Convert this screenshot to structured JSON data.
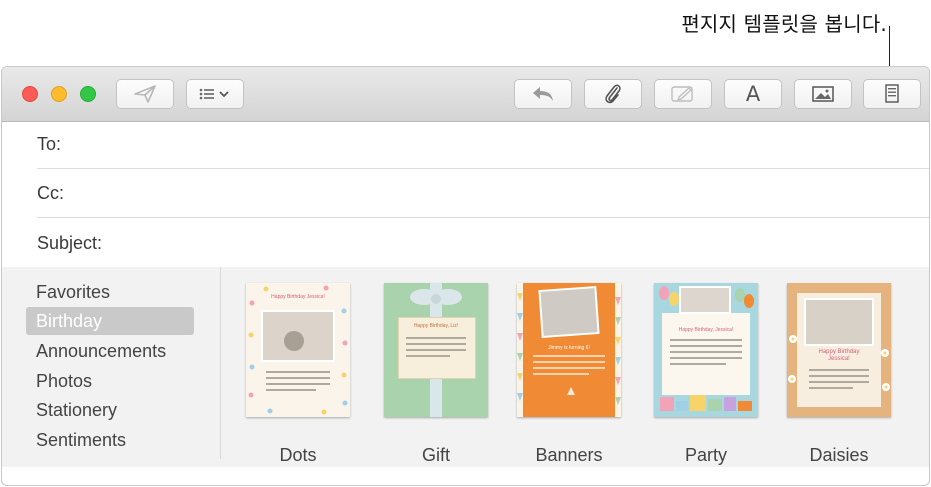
{
  "callout": {
    "text": "편지지 템플릿을 봅니다."
  },
  "headers": {
    "to": "To:",
    "cc": "Cc:",
    "subject": "Subject:"
  },
  "toolbar": {
    "font_label": "A"
  },
  "categories": [
    {
      "label": "Favorites",
      "selected": false
    },
    {
      "label": "Birthday",
      "selected": true
    },
    {
      "label": "Announcements",
      "selected": false
    },
    {
      "label": "Photos",
      "selected": false
    },
    {
      "label": "Stationery",
      "selected": false
    },
    {
      "label": "Sentiments",
      "selected": false
    }
  ],
  "templates": [
    {
      "name": "Dots",
      "heading": "Happy Birthday Jessica!"
    },
    {
      "name": "Gift",
      "heading": "Happy Birthday, Liz!"
    },
    {
      "name": "Banners",
      "heading": "Jimmy is turning 6!"
    },
    {
      "name": "Party",
      "heading": "Happy Birthday, Jessica!"
    },
    {
      "name": "Daisies",
      "heading": "Happy Birthday Jessica!"
    }
  ],
  "colors": {
    "accent_selected": "#c9c9c9",
    "close": "#fc5c55",
    "minimize": "#fdbc2e",
    "zoom": "#33c748"
  }
}
